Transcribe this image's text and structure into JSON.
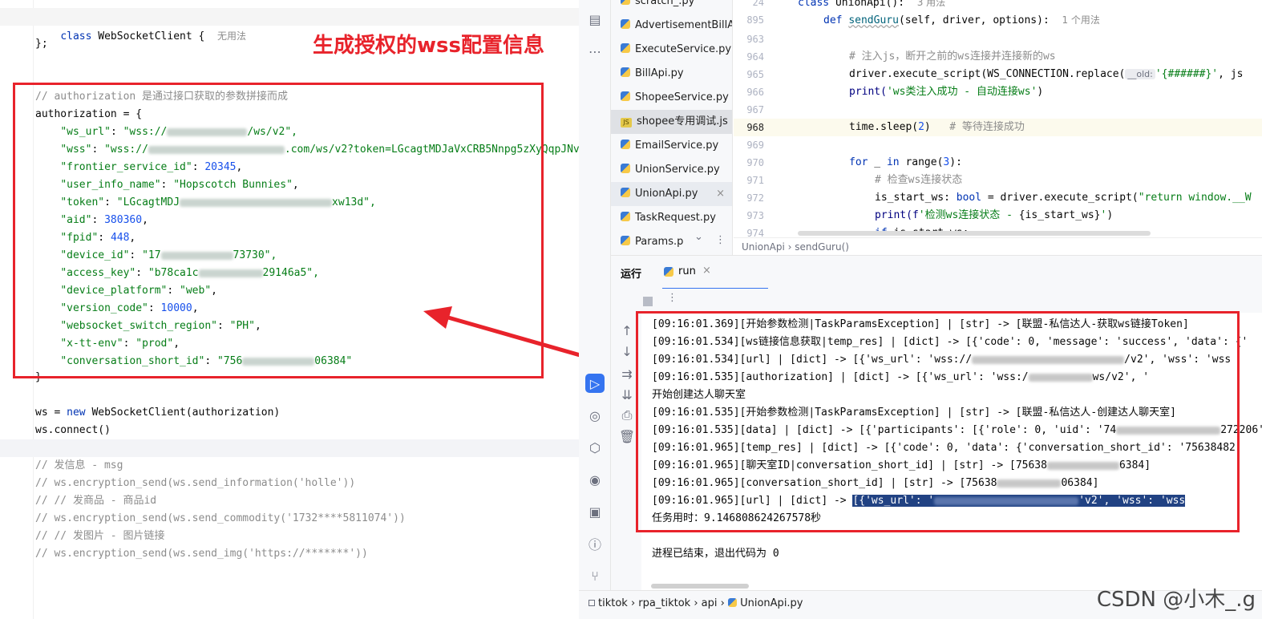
{
  "left_editor": {
    "header": {
      "keyword": "class",
      "name": "WebSocketClient {",
      "hint": "无用法"
    },
    "close_brace": "};",
    "annotation_title": "生成授权的wss配置信息",
    "comment_auth": "// authorization 是通过接口获取的参数拼接而成",
    "auth_open": "authorization = {",
    "auth_entries": [
      {
        "key": "\"ws_url\"",
        "pre": "\"wss://",
        "post": "/ws/v2\",",
        "type": "str"
      },
      {
        "key": "\"wss\"",
        "pre": "\"wss://",
        "post": ".com/ws/v2?token=LGcagtMDJaVxCRB5Nnpg5zXyQqpJNv",
        "type": "str"
      },
      {
        "key": "\"frontier_service_id\"",
        "value": "20345",
        "type": "num"
      },
      {
        "key": "\"user_info_name\"",
        "value": "\"Hopscotch Bunnies\"",
        "type": "str"
      },
      {
        "key": "\"token\"",
        "pre": "\"LGcagtMDJ",
        "post": "xw13d\",",
        "type": "str"
      },
      {
        "key": "\"aid\"",
        "value": "380360",
        "type": "num"
      },
      {
        "key": "\"fpid\"",
        "value": "448",
        "type": "num"
      },
      {
        "key": "\"device_id\"",
        "pre": "\"17",
        "post": "73730\",",
        "type": "str"
      },
      {
        "key": "\"access_key\"",
        "pre": "\"b78ca1c",
        "post": "29146a5\",",
        "type": "str"
      },
      {
        "key": "\"device_platform\"",
        "value": "\"web\"",
        "type": "str"
      },
      {
        "key": "\"version_code\"",
        "value": "10000",
        "type": "num"
      },
      {
        "key": "\"websocket_switch_region\"",
        "value": "\"PH\"",
        "type": "str"
      },
      {
        "key": "\"x-tt-env\"",
        "value": "\"prod\"",
        "type": "str"
      },
      {
        "key": "\"conversation_short_id\"",
        "pre": "\"756",
        "post": "06384\"",
        "type": "str",
        "last": true
      }
    ],
    "auth_close": "}",
    "ws_new": {
      "a": "ws = ",
      "b": "new",
      "c": " WebSocketClient(authorization)"
    },
    "ws_connect": "ws.connect()",
    "comments": [
      "// 发信息 - msg",
      "// ws.encryption_send(ws.send_information('holle'))",
      "// // 发商品 - 商品id",
      "// ws.encryption_send(ws.send_commodity('1732****5811074'))",
      "// // 发图片 - 图片链接",
      "// ws.encryption_send(ws.send_img('https://*******'))"
    ]
  },
  "files": [
    {
      "name": "scratch_.py",
      "icon": "py"
    },
    {
      "name": "AdvertisementBillApi",
      "icon": "py"
    },
    {
      "name": "ExecuteService.py",
      "icon": "py"
    },
    {
      "name": "BillApi.py",
      "icon": "py"
    },
    {
      "name": "ShopeeService.py",
      "icon": "py"
    },
    {
      "name": "shopee专用调试.js",
      "icon": "js",
      "state": "sel"
    },
    {
      "name": "EmailService.py",
      "icon": "py"
    },
    {
      "name": "UnionService.py",
      "icon": "py"
    },
    {
      "name": "UnionApi.py",
      "icon": "py",
      "state": "open"
    },
    {
      "name": "TaskRequest.py",
      "icon": "py"
    },
    {
      "name": "Params.p",
      "icon": "py"
    }
  ],
  "right_editor": {
    "lines": [
      {
        "n": "24",
        "t": "class UnionApi():  3 用法"
      },
      {
        "n": "895",
        "t": ""
      },
      {
        "n": "963",
        "t": ""
      },
      {
        "n": "964",
        "t": "# 注入js，断开之前的ws连接并连接新的ws"
      },
      {
        "n": "965",
        "t": ""
      },
      {
        "n": "966",
        "t": ""
      },
      {
        "n": "967",
        "t": ""
      },
      {
        "n": "968",
        "t": ""
      },
      {
        "n": "969",
        "t": ""
      },
      {
        "n": "970",
        "t": ""
      },
      {
        "n": "971",
        "t": "# 检查ws连接状态"
      },
      {
        "n": "972",
        "t": ""
      },
      {
        "n": "973",
        "t": ""
      },
      {
        "n": "974",
        "t": ""
      }
    ],
    "def_line": {
      "kw": "def",
      "fn": "sendGuru",
      "args": "(self, driver, options):",
      "hint": "1 个用法"
    },
    "exec_line": {
      "a": "driver.execute_script(WS_CONNECTION.replace(",
      "hint": "__old:",
      "b": "'{######}'",
      ",c": ", js"
    },
    "print1": {
      "a": "print(",
      "s": "'ws类注入成功 - 自动连接ws'",
      "c": ")"
    },
    "sleep": {
      "a": "time.sleep(",
      "n": "2",
      "c": ")",
      "cm": "# 等待连接成功"
    },
    "for_line": {
      "kw": "for",
      "a": " _ ",
      "kw2": "in",
      "b": " range(",
      "n": "3",
      "c": "):"
    },
    "is_start": {
      "a": "is_start_ws: ",
      "t": "bool",
      "b": " = driver.execute_script(",
      "s": "\"return window.__W"
    },
    "print2": {
      "a": "print(f",
      "s1": "'检测ws连接状态 - ",
      "v": "{is_start_ws}",
      "s2": "'",
      ")": ")"
    },
    "if_line": {
      "kw": "if",
      "a": " is_start_ws:"
    },
    "breadcrumb": [
      "UnionApi",
      "sendGuru()"
    ]
  },
  "run_panel": {
    "tab_label": "运行",
    "config_name": "run",
    "lines": [
      "[09:16:01.369][开始参数检测|TaskParamsException] | [str] -> [联盟-私信达人-获取ws链接Token]",
      "[09:16:01.534][ws链接信息获取|temp_res] | [dict] -> [{'code': 0, 'message': 'success', 'data': {'",
      "[09:16:01.534][url] | [dict] -> [{'ws_url': 'wss://",
      "[09:16:01.535][authorization] | [dict] -> [{'ws_url': 'wss:/",
      "开始创建达人聊天室",
      "[09:16:01.535][开始参数检测|TaskParamsException] | [str] -> [联盟-私信达人-创建达人聊天室]",
      "[09:16:01.535][data] | [dict] -> [{'participants': [{'role': 0, 'uid': '74",
      "[09:16:01.965][temp_res] | [dict] -> [{'code': 0, 'data': {'conversation_short_id': '75638482",
      "[09:16:01.965][聊天室ID|conversation_short_id] | [str] -> [75638",
      "[09:16:01.965][conversation_short_id] | [str] -> [75638",
      "[09:16:01.965][url] | [dict] -> ",
      "任务用时：9.146808624267578秒",
      "",
      "进程已结束，退出代码为 0"
    ],
    "line_tails": [
      "",
      "",
      "/v2', 'wss': 'wss",
      "ws/v2', '",
      "",
      "",
      "272206', '",
      "",
      "6384]",
      "06384]",
      "'v2', 'wss': 'wss",
      "",
      "",
      ""
    ],
    "selected_tail": "[{'ws_url': '"
  },
  "status_path": [
    "tiktok",
    "rpa_tiktok",
    "api",
    "UnionApi.py"
  ],
  "watermark": "CSDN @小木_.g"
}
